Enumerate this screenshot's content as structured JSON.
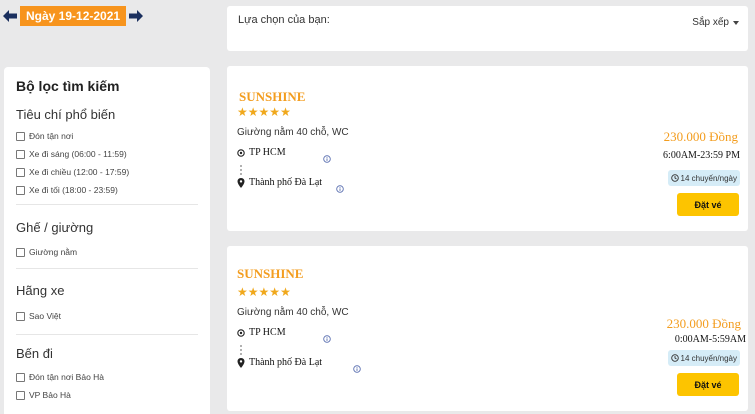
{
  "date_nav": {
    "label": "Ngày 19-12-2021"
  },
  "sidebar": {
    "title": "Bộ lọc tìm kiếm",
    "sections": [
      {
        "heading": "Tiêu chí phổ biến",
        "options": [
          "Đón tận nơi",
          "Xe đi sáng (06:00 - 11:59)",
          "Xe đi chiều (12:00 - 17:59)",
          "Xe đi tối (18:00 - 23:59)"
        ]
      },
      {
        "heading": "Ghế / giường",
        "options": [
          "Giường nằm"
        ]
      },
      {
        "heading": "Hãng xe",
        "options": [
          "Sao Việt"
        ]
      },
      {
        "heading": "Bến đi",
        "options": [
          "Đón tận nơi Bảo Hà",
          "VP Bảo Hà"
        ]
      }
    ]
  },
  "topbar": {
    "label": "Lựa chọn của bạn:",
    "sort_label": "Sắp xếp"
  },
  "results": [
    {
      "brand": "SUNSHINE",
      "rating": 5,
      "bus_type": "Giường nằm 40 chỗ, WC",
      "origin": "TP HCM",
      "destination": "Thành phố Đà Lạt",
      "price": "230.000 Đồng",
      "time": "6:00AM-23:59 PM",
      "trips": "14 chuyến/ngày",
      "book_label": "Đặt vé"
    },
    {
      "brand": "SUNSHINE",
      "rating": 5,
      "bus_type": "Giường nằm 40 chỗ, WC",
      "origin": "TP HCM",
      "destination": "Thành phố Đà Lạt",
      "price": "230.000 Đồng",
      "time": "0:00AM-5:59AM",
      "trips": "14 chuyến/ngày",
      "book_label": "Đặt vé"
    }
  ],
  "colors": {
    "accent": "#f7941d",
    "brand": "#f39d1f",
    "button": "#fdc400",
    "badge_bg": "#d5ecf7",
    "nav_arrow": "#1a2f5e"
  },
  "icons": [
    "arrow-left-icon",
    "arrow-right-icon",
    "caret-down-icon",
    "star-icon",
    "origin-icon",
    "location-pin-icon",
    "info-icon",
    "clock-icon"
  ]
}
